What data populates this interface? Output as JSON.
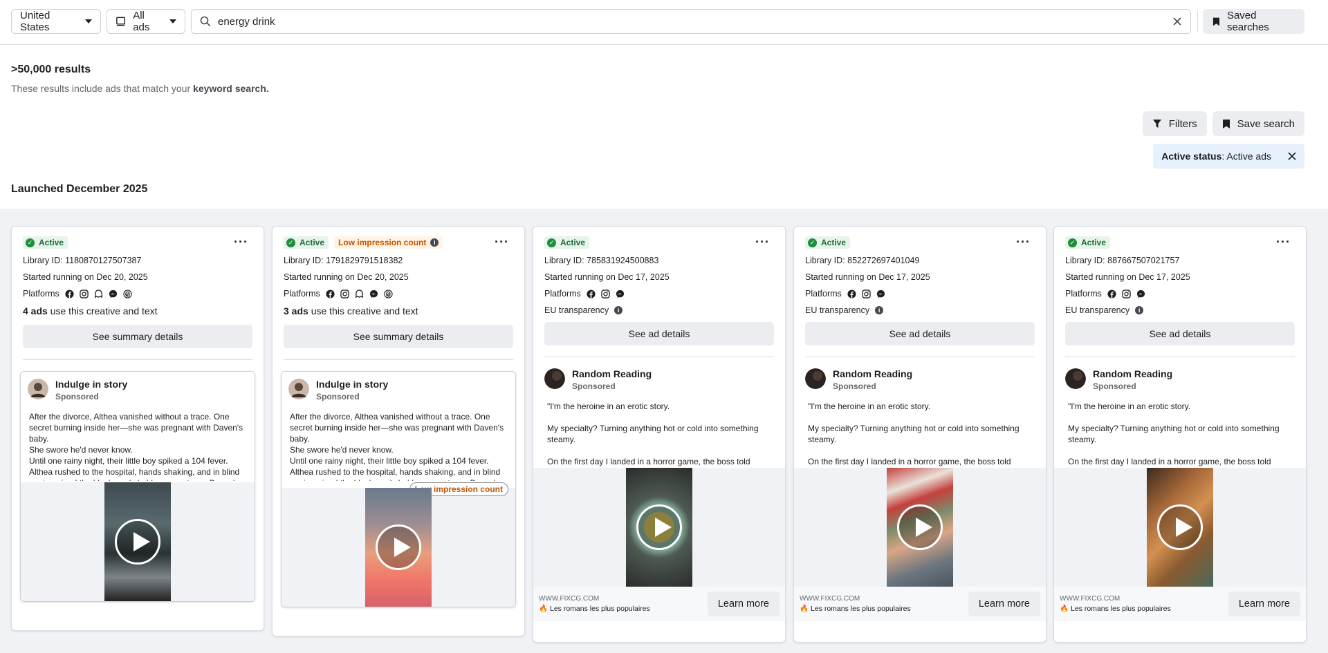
{
  "topbar": {
    "country": "United States",
    "ad_type": "All ads",
    "search_value": "energy drink",
    "saved_searches": "Saved searches"
  },
  "results": {
    "count": ">50,000 results",
    "desc_prefix": "These results include ads that match your",
    "desc_bold": "keyword search."
  },
  "tools": {
    "filters": "Filters",
    "save_search": "Save search"
  },
  "filter_chip": {
    "label": "Active status",
    "value": ": Active ads"
  },
  "section_title": "Launched December 2025",
  "colors": {
    "active_green": "#1e8e3e",
    "low_orange": "#c45500",
    "chip_bg": "#e7f0fd"
  },
  "cards": [
    {
      "status": "Active",
      "low_impression": "",
      "library_id": "Library ID: 1180870127507387",
      "started": "Started running on Dec 20, 2025",
      "platforms_label": "Platforms",
      "ads_count": "4 ads",
      "ads_suffix": " use this creative and text",
      "button": "See summary details",
      "advertiser": "Indulge in story",
      "sponsored": "Sponsored",
      "body": [
        "After the divorce, Althea vanished without a trace. One secret burning inside her—she was pregnant with Daven's baby.",
        "She swore he'd never know.",
        "Until one rainy night, their little boy spiked a 104 fever. Althea rushed to the hospital, hands shaking, and in blind panic swiped the black card she'd never cut up—Daven's ..."
      ]
    },
    {
      "status": "Active",
      "low_impression": "Low impression count",
      "library_id": "Library ID: 1791829791518382",
      "started": "Started running on Dec 20, 2025",
      "platforms_label": "Platforms",
      "ads_count": "3 ads",
      "ads_suffix": " use this creative and text",
      "button": "See summary details",
      "advertiser": "Indulge in story",
      "sponsored": "Sponsored",
      "media_tag": "Low impression count",
      "body": [
        "After the divorce, Althea vanished without a trace. One secret burning inside her—she was pregnant with Daven's baby.",
        "She swore he'd never know.",
        "Until one rainy night, their little boy spiked a 104 fever. Althea rushed to the hospital, hands shaking, and in blind panic swiped the black card she'd never cut up—Daven's ..."
      ]
    },
    {
      "status": "Active",
      "library_id": "Library ID: 785831924500883",
      "started": "Started running on Dec 17, 2025",
      "platforms_label": "Platforms",
      "eu": "EU transparency",
      "button": "See ad details",
      "advertiser": "Random Reading",
      "sponsored": "Sponsored",
      "body": [
        "\"I'm the heroine in an erotic story.",
        "My specialty? Turning anything hot or cold into something steamy.",
        "On the first day I landed in a horror game, the boss told everyone to choose how they wanted to die...."
      ],
      "cta_url": "WWW.FIXCG.COM",
      "cta_title": "🔥 Les romans les plus populaires",
      "cta_button": "Learn more"
    },
    {
      "status": "Active",
      "library_id": "Library ID: 852272697401049",
      "started": "Started running on Dec 17, 2025",
      "platforms_label": "Platforms",
      "eu": "EU transparency",
      "button": "See ad details",
      "advertiser": "Random Reading",
      "sponsored": "Sponsored",
      "body": [
        "\"I'm the heroine in an erotic story.",
        "My specialty? Turning anything hot or cold into something steamy.",
        "On the first day I landed in a horror game, the boss told everyone to choose how they wanted to die...."
      ],
      "cta_url": "WWW.FIXCG.COM",
      "cta_title": "🔥 Les romans les plus populaires",
      "cta_button": "Learn more"
    },
    {
      "status": "Active",
      "library_id": "Library ID: 887667507021757",
      "started": "Started running on Dec 17, 2025",
      "platforms_label": "Platforms",
      "eu": "EU transparency",
      "button": "See ad details",
      "advertiser": "Random Reading",
      "sponsored": "Sponsored",
      "body": [
        "\"I'm the heroine in an erotic story.",
        "My specialty? Turning anything hot or cold into something steamy.",
        "On the first day I landed in a horror game, the boss told everyone to choose how they wanted to die...."
      ],
      "cta_url": "WWW.FIXCG.COM",
      "cta_title": "🔥 Les romans les plus populaires",
      "cta_button": "Learn more"
    }
  ]
}
